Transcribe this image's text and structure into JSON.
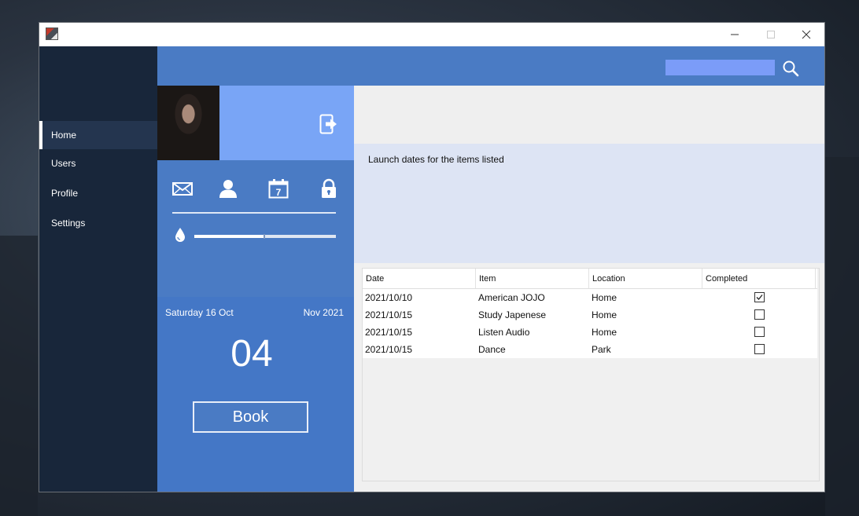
{
  "window": {
    "minimize_icon": "minimize-icon",
    "maximize_icon": "maximize-icon",
    "close_icon": "close-icon"
  },
  "sidebar": {
    "items": [
      {
        "label": "Home",
        "active": true
      },
      {
        "label": "Users",
        "active": false
      },
      {
        "label": "Profile",
        "active": false
      },
      {
        "label": "Settings",
        "active": false
      }
    ]
  },
  "search": {
    "value": "",
    "placeholder": "",
    "icon": "search-icon"
  },
  "profile": {
    "icons": [
      "logout-icon",
      "mail-icon",
      "user-icon",
      "calendar-icon",
      "lock-icon",
      "drop-icon"
    ],
    "calendar_icon_number": "7",
    "slider_value": 0.49
  },
  "date_card": {
    "weekday_date": "Saturday 16 Oct",
    "month_year": "Nov 2021",
    "day": "04",
    "book_label": "Book"
  },
  "description": {
    "text": "Launch dates for the items listed"
  },
  "table": {
    "columns": [
      "Date",
      "Item",
      "Location",
      "Completed"
    ],
    "rows": [
      {
        "date": "2021/10/10",
        "item": "American JOJO",
        "location": "Home",
        "completed": true
      },
      {
        "date": "2021/10/15",
        "item": "Study Japenese",
        "location": "Home",
        "completed": false
      },
      {
        "date": "2021/10/15",
        "item": "Listen Audio",
        "location": "Home",
        "completed": false
      },
      {
        "date": "2021/10/15",
        "item": "Dance",
        "location": "Park",
        "completed": false
      }
    ]
  },
  "colors": {
    "sidebar": "#18263a",
    "accent_blue": "#4a7bc4",
    "light_blue": "#79a5f6",
    "search_field": "#7b9cf8",
    "description_bg": "#dde4f4"
  }
}
